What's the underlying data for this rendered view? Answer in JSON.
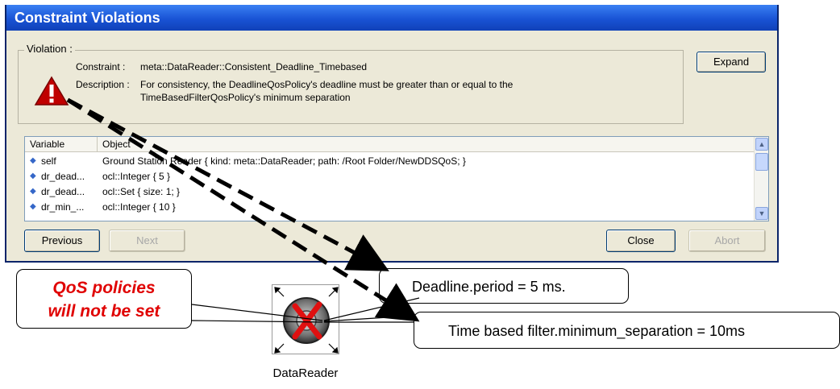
{
  "window": {
    "title": "Constraint Violations"
  },
  "violation": {
    "legend": "Violation :",
    "constraint_label": "Constraint :",
    "constraint_value": "meta::DataReader::Consistent_Deadline_Timebased",
    "description_label": "Description :",
    "description_line1": "For consistency, the DeadlineQosPolicy's deadline must be greater than or equal to the",
    "description_line2": "TimeBasedFilterQosPolicy's minimum separation",
    "icon": "warning-icon"
  },
  "buttons": {
    "expand": "Expand",
    "previous": "Previous",
    "next": "Next",
    "close": "Close",
    "abort": "Abort"
  },
  "table": {
    "columns": [
      "Variable",
      "Object"
    ],
    "rows": [
      {
        "variable": "self",
        "object": "Ground Station Reader { kind: meta::DataReader; path: /Root Folder/NewDDSQoS; }"
      },
      {
        "variable": "dr_dead...",
        "object": "ocl::Integer { 5 }"
      },
      {
        "variable": "dr_dead...",
        "object": "ocl::Set { size: 1; }"
      },
      {
        "variable": "dr_min_...",
        "object": "ocl::Integer { 10 }"
      }
    ]
  },
  "callouts": {
    "qos_line1": "QoS policies",
    "qos_line2": "will not be set",
    "deadline": "Deadline.period = 5 ms.",
    "time_based_filter": "Time  based filter.minimum_separation = 10ms"
  },
  "icon": {
    "name": "DataReader",
    "status": "error-x-overlay"
  },
  "colors": {
    "title_bar": "#1953d5",
    "dialog_bg": "#ece9d8",
    "warning_red": "#c00000",
    "callout_red_text": "#e00000"
  }
}
